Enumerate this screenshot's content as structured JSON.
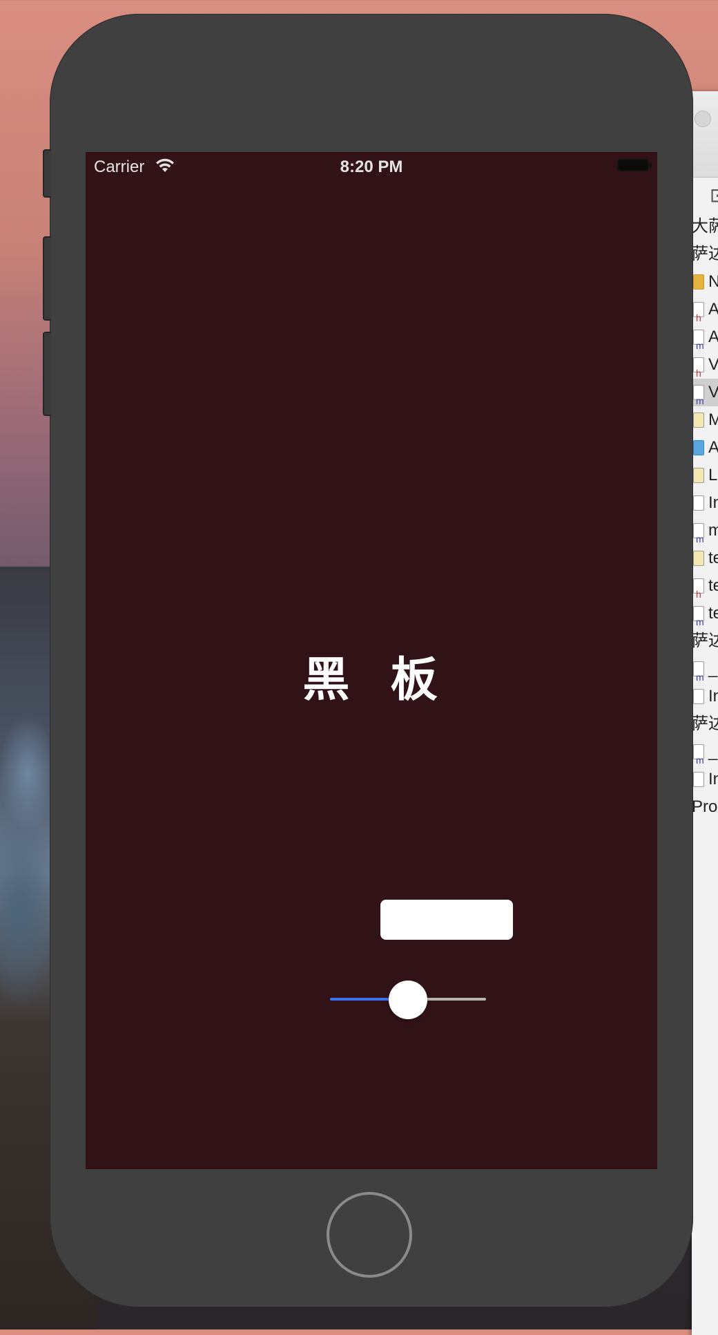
{
  "status_bar": {
    "carrier": "Carrier",
    "time": "8:20 PM",
    "icons": [
      "wifi-icon",
      "battery-icon"
    ]
  },
  "app": {
    "title": "黑  板",
    "button_label": "",
    "slider": {
      "value": 0.5,
      "min_color": "#3b73f0",
      "max_color": "#b9b3b4"
    },
    "background_color": "#311217"
  },
  "xcode_navigator": {
    "rows": [
      {
        "text": "大萨",
        "icon": "none"
      },
      {
        "text": "萨达",
        "icon": "none"
      },
      {
        "text": "N",
        "icon": "folder"
      },
      {
        "text": "A",
        "icon": "h"
      },
      {
        "text": "A",
        "icon": "m"
      },
      {
        "text": "V",
        "icon": "h"
      },
      {
        "text": "V",
        "icon": "m",
        "selected": true
      },
      {
        "text": "M",
        "icon": "plist"
      },
      {
        "text": "A",
        "icon": "asset"
      },
      {
        "text": "L",
        "icon": "plist"
      },
      {
        "text": "In",
        "icon": "file"
      },
      {
        "text": "m",
        "icon": "m"
      },
      {
        "text": "te",
        "icon": "plist"
      },
      {
        "text": "te",
        "icon": "h"
      },
      {
        "text": "te",
        "icon": "m"
      },
      {
        "text": "萨达",
        "icon": "none"
      },
      {
        "text": "_",
        "icon": "m"
      },
      {
        "text": "In",
        "icon": "file"
      },
      {
        "text": "萨达",
        "icon": "none"
      },
      {
        "text": "_",
        "icon": "m"
      },
      {
        "text": "In",
        "icon": "file"
      },
      {
        "text": "Proc",
        "icon": "none"
      }
    ]
  }
}
